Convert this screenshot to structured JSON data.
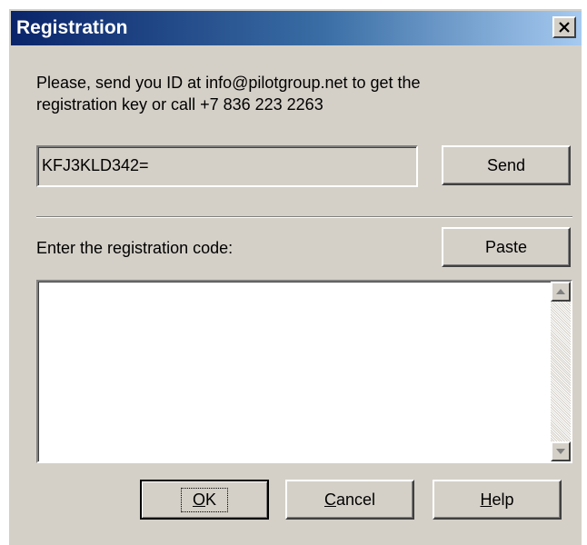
{
  "window": {
    "title": "Registration",
    "close_icon": "close-icon"
  },
  "message": {
    "line1": "Please, send you ID at info@pilotgroup.net to get the",
    "line2": "registration key or call +7 836 223 2263"
  },
  "id_field": {
    "value": "KFJ3KLD342="
  },
  "buttons": {
    "send": "Send",
    "paste": "Paste",
    "ok": "OK",
    "cancel": "Cancel",
    "help": "Help"
  },
  "code_prompt": "Enter the registration code:",
  "code_field": {
    "value": ""
  },
  "icons": {
    "close": "close-icon",
    "scroll_up": "arrow-up-icon",
    "scroll_down": "arrow-down-icon"
  },
  "colors": {
    "title_gradient_start": "#0a246a",
    "title_gradient_end": "#a6caf0",
    "dialog_face": "#d4d0c8"
  }
}
